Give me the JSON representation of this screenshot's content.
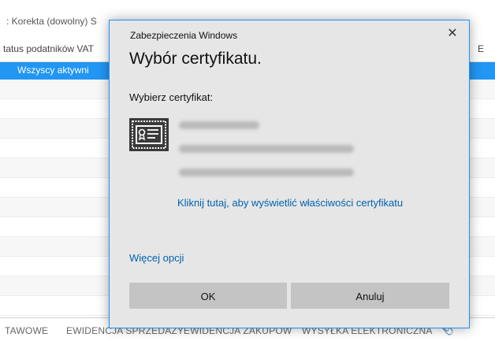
{
  "background": {
    "toolbar_label": ": Korekta (dowolny)  S",
    "header_col1": "tatus podatników VAT",
    "header_col2": "E",
    "selected_row": "Wszyscy aktywni",
    "tabs": [
      "TAWOWE",
      "EWIDENCJA SPRZEDAŻY",
      "EWIDENCJA ZAKUPÓW",
      "WYSYŁKA ELEKTRONICZNA"
    ]
  },
  "dialog": {
    "caption": "Zabezpieczenia Windows",
    "close_glyph": "✕",
    "title": "Wybór certyfikatu.",
    "prompt": "Wybierz certyfikat:",
    "link": "Kliknij tutaj, aby wyświetlić właściwości certyfikatu",
    "more_options": "Więcej opcji",
    "ok": "OK",
    "cancel": "Anuluj"
  },
  "icons": {
    "certificate": "certificate-icon",
    "paperclip": "paperclip-icon",
    "close": "close-icon"
  },
  "colors": {
    "accent": "#2196f3",
    "link": "#0063b1",
    "dialog_bg": "#e6e6e6",
    "button": "#c4c4c4"
  }
}
